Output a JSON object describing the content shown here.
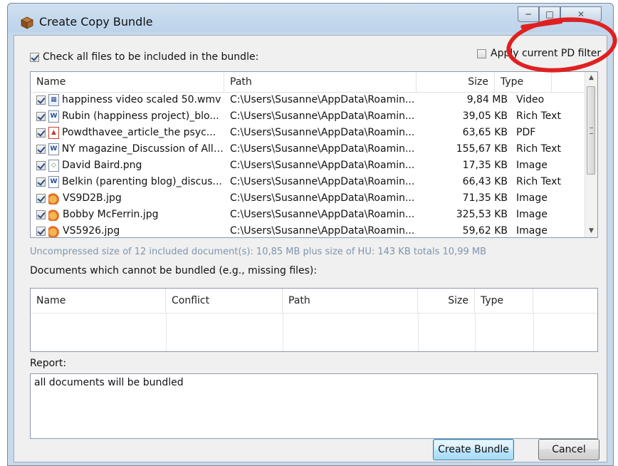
{
  "window": {
    "title": "Create Copy Bundle"
  },
  "options": {
    "check_all_label": "Check all files to be included in the bundle:",
    "check_all_checked": true,
    "pd_filter_label": "Apply current PD filter",
    "pd_filter_checked": false
  },
  "files_table": {
    "columns": {
      "name": "Name",
      "path": "Path",
      "size": "Size",
      "type": "Type"
    },
    "rows": [
      {
        "checked": true,
        "icon": "video-file-icon",
        "name": "happiness video scaled 50.wmv",
        "path": "C:\\Users\\Susanne\\AppData\\Roamin...",
        "size": "9,84 MB",
        "type": "Video"
      },
      {
        "checked": true,
        "icon": "word-document-icon",
        "name": "Rubin (happiness project)_blo...",
        "path": "C:\\Users\\Susanne\\AppData\\Roamin...",
        "size": "39,05 KB",
        "type": "Rich Text"
      },
      {
        "checked": true,
        "icon": "pdf-file-icon",
        "name": "Powdthavee_article_the psyc...",
        "path": "C:\\Users\\Susanne\\AppData\\Roamin...",
        "size": "63,65 KB",
        "type": "PDF"
      },
      {
        "checked": true,
        "icon": "word-document-icon",
        "name": "NY magazine_Discussion of All ...",
        "path": "C:\\Users\\Susanne\\AppData\\Roamin...",
        "size": "155,67 KB",
        "type": "Rich Text"
      },
      {
        "checked": true,
        "icon": "png-image-icon",
        "name": "David Baird.png",
        "path": "C:\\Users\\Susanne\\AppData\\Roamin...",
        "size": "17,35 KB",
        "type": "Image"
      },
      {
        "checked": true,
        "icon": "word-document-icon",
        "name": "Belkin (parenting blog)_discus...",
        "path": "C:\\Users\\Susanne\\AppData\\Roamin...",
        "size": "66,43 KB",
        "type": "Rich Text"
      },
      {
        "checked": true,
        "icon": "jpg-image-icon",
        "name": "VS9D2B.jpg",
        "path": "C:\\Users\\Susanne\\AppData\\Roamin...",
        "size": "71,35 KB",
        "type": "Image"
      },
      {
        "checked": true,
        "icon": "jpg-image-icon",
        "name": "Bobby McFerrin.jpg",
        "path": "C:\\Users\\Susanne\\AppData\\Roamin...",
        "size": "325,53 KB",
        "type": "Image"
      },
      {
        "checked": true,
        "icon": "jpg-image-icon",
        "name": "VS5926.jpg",
        "path": "C:\\Users\\Susanne\\AppData\\Roamin...",
        "size": "59,62 KB",
        "type": "Image"
      }
    ]
  },
  "summary": "Uncompressed size of 12 included document(s): 10,85 MB plus size of HU: 143 KB totals 10,99 MB",
  "unbundled": {
    "label": "Documents which cannot be bundled (e.g., missing files):",
    "columns": {
      "name": "Name",
      "conflict": "Conflict",
      "path": "Path",
      "size": "Size",
      "type": "Type"
    }
  },
  "report": {
    "label": "Report:",
    "text": "all documents will be bundled"
  },
  "buttons": {
    "create": "Create Bundle",
    "cancel": "Cancel"
  },
  "colors": {
    "annotation": "#e02020",
    "summary_text": "#7f95ad"
  }
}
